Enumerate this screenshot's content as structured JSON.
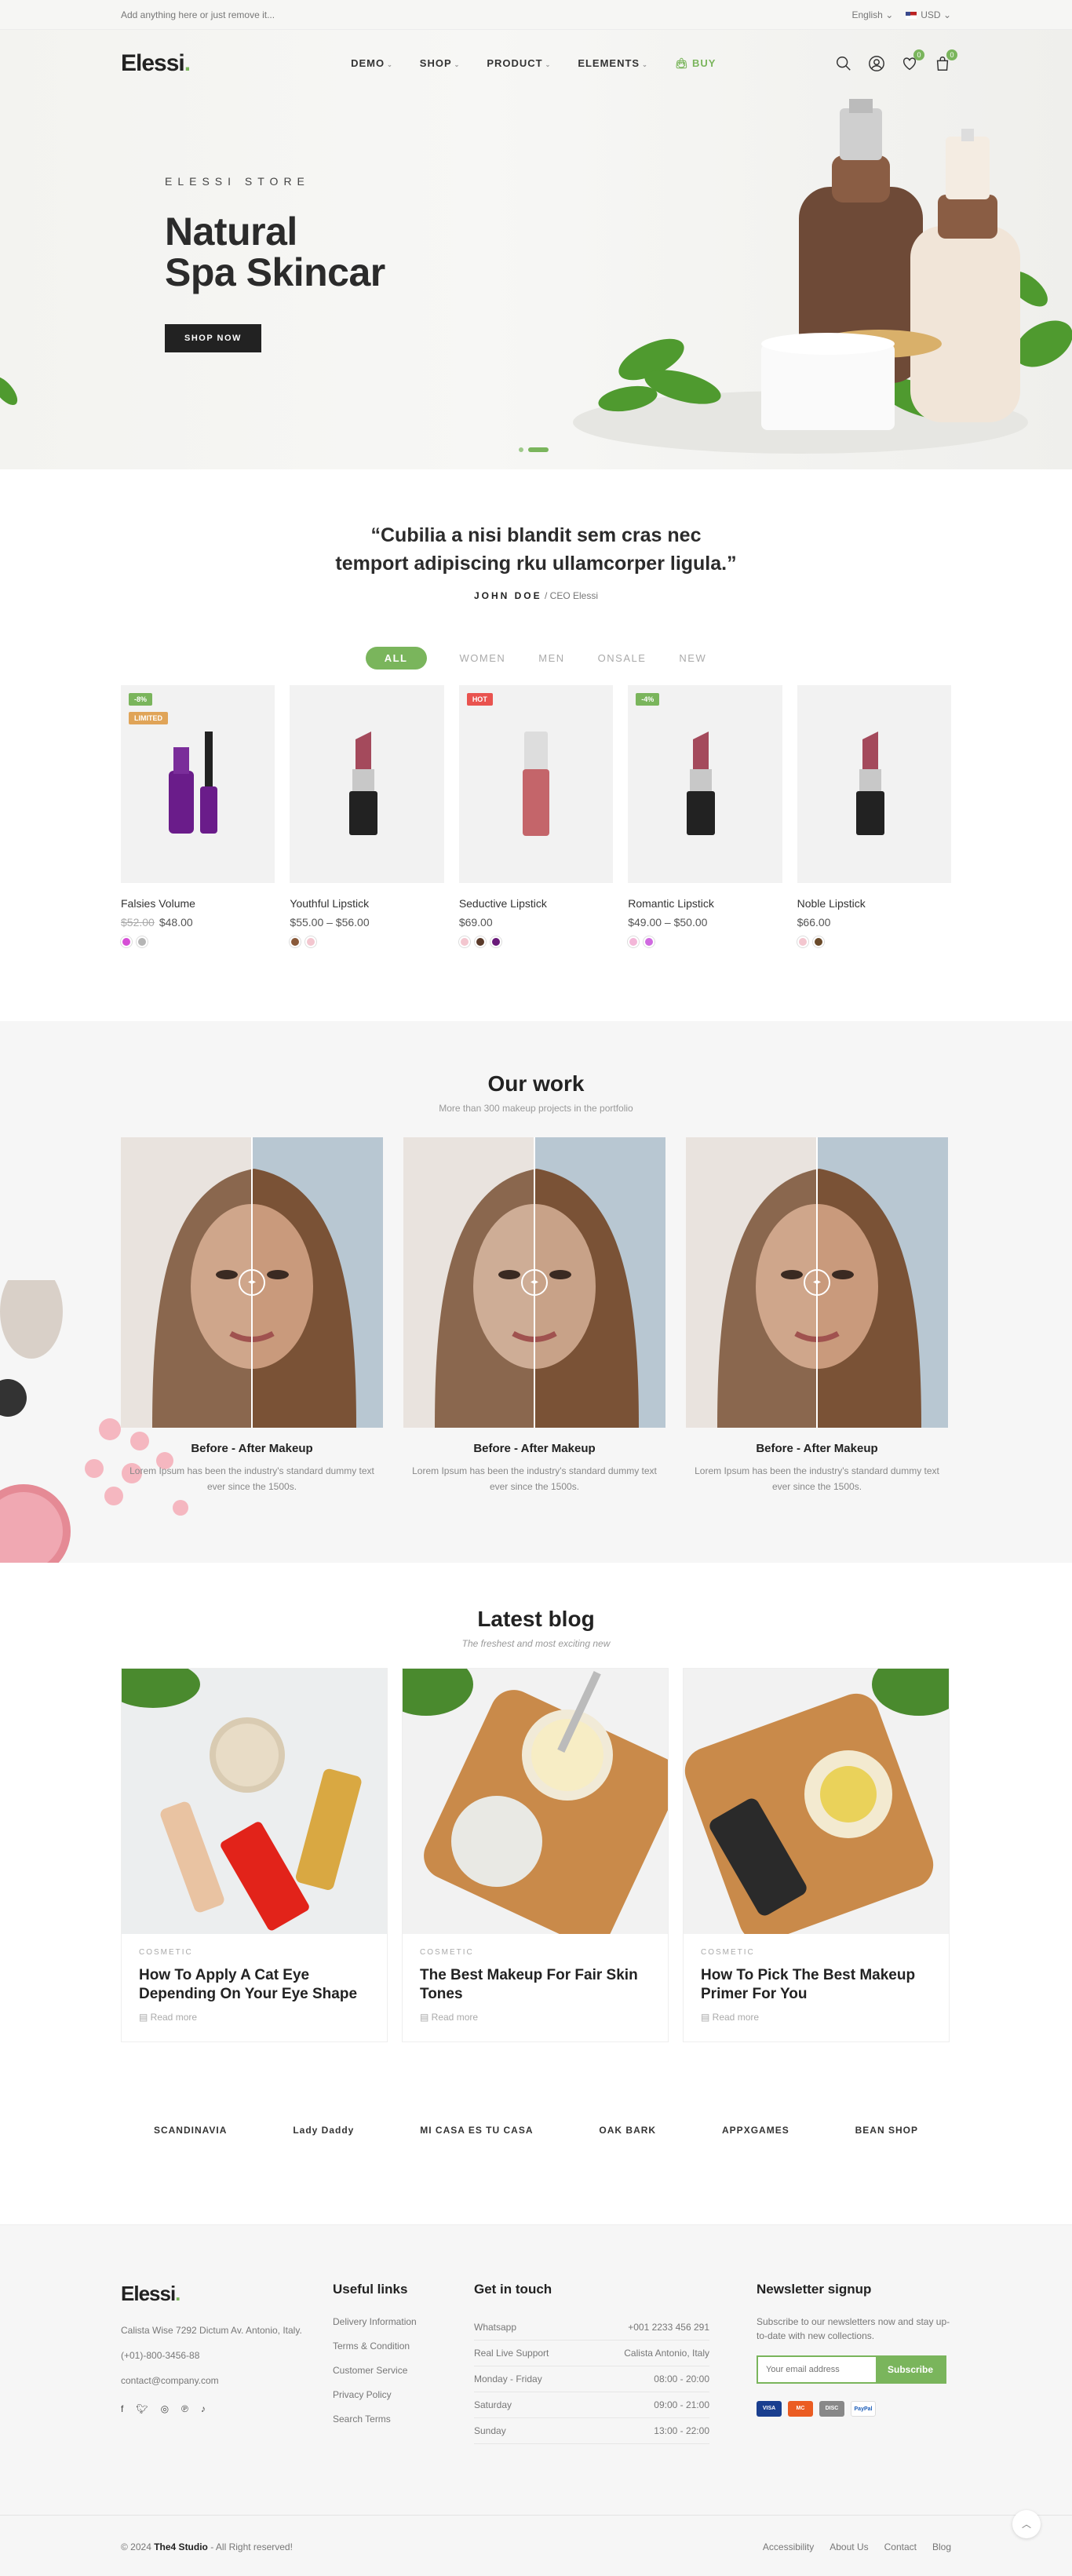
{
  "topbar": {
    "announcement": "Add anything here or just remove it...",
    "language": "English",
    "currency": "USD"
  },
  "header": {
    "logo": "Elessi",
    "nav": [
      {
        "label": "DEMO"
      },
      {
        "label": "SHOP"
      },
      {
        "label": "PRODUCT"
      },
      {
        "label": "ELEMENTS"
      },
      {
        "label": "BUY"
      }
    ],
    "wishlist_count": "0",
    "cart_count": "0"
  },
  "hero": {
    "eyebrow": "ELESSI STORE",
    "title_line1": "Natural",
    "title_line2": "Spa Skincar",
    "cta": "SHOP NOW"
  },
  "testimonial": {
    "line1": "“Cubilia a nisi blandit sem cras nec",
    "line2": "temport adipiscing rku ullamcorper ligula.”",
    "name": "JOHN DOE",
    "role": "/ CEO Elessi"
  },
  "tabs": [
    "ALL",
    "WOMEN",
    "MEN",
    "ONSALE",
    "NEW"
  ],
  "products": [
    {
      "name": "Falsies Volume",
      "old_price": "$52.00",
      "price": "$48.00",
      "tags": [
        {
          "text": "-8%",
          "color": "#7ab55c"
        },
        {
          "text": "LIMITED",
          "color": "#e0a458"
        }
      ],
      "swatches": [
        "#d64fd6",
        "#b5b5b5"
      ],
      "icon": "mascara-icon"
    },
    {
      "name": "Youthful Lipstick",
      "old_price": "",
      "price": "$55.00 – $56.00",
      "tags": [],
      "swatches": [
        "#8a5a3a",
        "#f3c6cf"
      ],
      "icon": "lipstick-icon"
    },
    {
      "name": "Seductive Lipstick",
      "old_price": "",
      "price": "$69.00",
      "tags": [
        {
          "text": "HOT",
          "color": "#e9534f"
        }
      ],
      "swatches": [
        "#f3c6cf",
        "#5a3a2a",
        "#6a1a7a"
      ],
      "icon": "lipgloss-icon"
    },
    {
      "name": "Romantic Lipstick",
      "old_price": "",
      "price": "$49.00 – $50.00",
      "tags": [
        {
          "text": "-4%",
          "color": "#7ab55c"
        }
      ],
      "swatches": [
        "#f3b6d8",
        "#d06ae0"
      ],
      "icon": "lipstick-icon"
    },
    {
      "name": "Noble Lipstick",
      "old_price": "",
      "price": "$66.00",
      "tags": [],
      "swatches": [
        "#f3c6cf",
        "#6a4a2a"
      ],
      "icon": "lipstick-icon"
    }
  ],
  "work": {
    "title": "Our work",
    "subtitle": "More than 300 makeup projects in the portfolio",
    "items": [
      {
        "title": "Before - After Makeup",
        "text": "Lorem Ipsum has been the industry's standard dummy text ever since the 1500s."
      },
      {
        "title": "Before - After Makeup",
        "text": "Lorem Ipsum has been the industry's standard dummy text ever since the 1500s."
      },
      {
        "title": "Before - After Makeup",
        "text": "Lorem Ipsum has been the industry's standard dummy text ever since the 1500s."
      }
    ]
  },
  "blog": {
    "title": "Latest blog",
    "subtitle": "The freshest and most exciting new",
    "posts": [
      {
        "category": "COSMETIC",
        "title": "How To Apply A Cat Eye Depending On Your Eye Shape",
        "more": "Read more"
      },
      {
        "category": "COSMETIC",
        "title": "The Best Makeup For Fair Skin Tones",
        "more": "Read more"
      },
      {
        "category": "COSMETIC",
        "title": "How To Pick The Best Makeup Primer For You",
        "more": "Read more"
      }
    ]
  },
  "brands": [
    "SCANDINAVIA",
    "Lady Daddy",
    "MI CASA ES TU CASA",
    "OAK BARK",
    "APPXGAMES",
    "BEAN SHOP"
  ],
  "footer": {
    "logo": "Elessi",
    "address": "Calista Wise 7292 Dictum Av. Antonio, Italy.",
    "phone": "(+01)-800-3456-88",
    "email": "contact@company.com",
    "social": [
      "f",
      "t",
      "ig",
      "p",
      "tk"
    ],
    "useful_title": "Useful links",
    "useful": [
      "Delivery Information",
      "Terms & Condition",
      "Customer Service",
      "Privacy Policy",
      "Search Terms"
    ],
    "touch_title": "Get in touch",
    "touch": [
      {
        "k": "Whatsapp",
        "v": "+001 2233 456 291"
      },
      {
        "k": "Real Live Support",
        "v": "Calista Antonio, Italy"
      },
      {
        "k": "Monday - Friday",
        "v": "08:00 - 20:00"
      },
      {
        "k": "Saturday",
        "v": "09:00 - 21:00"
      },
      {
        "k": "Sunday",
        "v": "13:00 - 22:00"
      }
    ],
    "news_title": "Newsletter signup",
    "news_text": "Subscribe to our newsletters now and stay up-to-date with new collections.",
    "email_placeholder": "Your email address",
    "subscribe": "Subscribe",
    "payment": [
      "VISA",
      "MC",
      "DISC",
      "PayPal"
    ]
  },
  "bottom": {
    "copyright_prefix": "© 2024",
    "studio": "The4 Studio",
    "copyright_suffix": "- All Right reserved!",
    "links": [
      "Accessibility",
      "About Us",
      "Contact",
      "Blog"
    ]
  }
}
